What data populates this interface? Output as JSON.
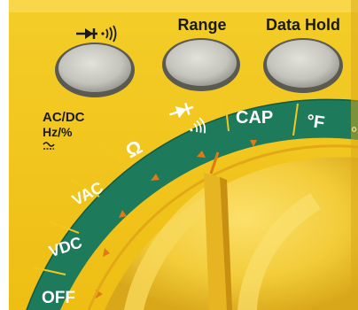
{
  "buttons": {
    "diode_label": "→▸| ·)))",
    "range_label": "Range",
    "data_hold_label": "Data Hold"
  },
  "side_labels": {
    "ac_dc": "AC/DC",
    "hz": "Hz/%",
    "wave": "≈"
  },
  "dial": {
    "off": "OFF",
    "vdc": "VDC",
    "vac": "VAC",
    "ohm": "Ω",
    "diode": "·)))",
    "cap": "CAP",
    "fahrenheit": "°F",
    "celsius_partial": "°"
  },
  "colors": {
    "case_yellow": "#f2c81e",
    "button_gray": "#c8c8c0",
    "band_green": "#1d7a5a",
    "knob_yellow": "#f6d14a",
    "marker_orange": "#e07a18"
  }
}
